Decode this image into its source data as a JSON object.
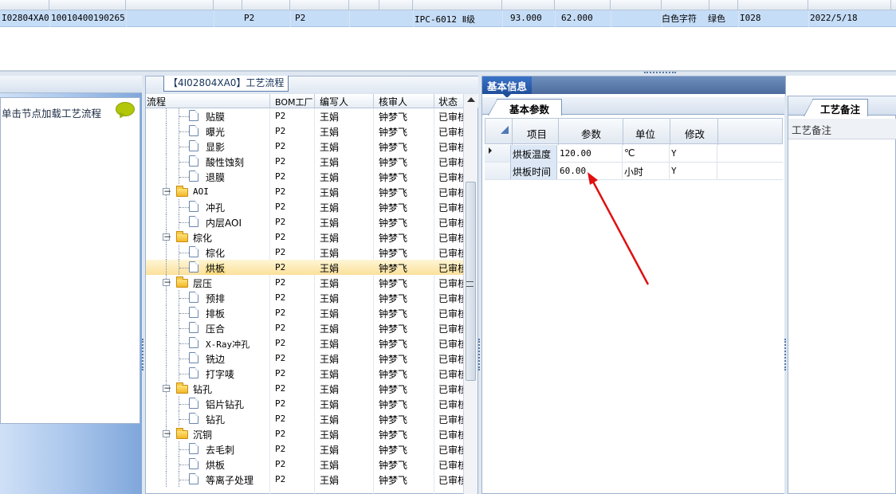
{
  "top_grid": {
    "selected_row": {
      "code": "I02804XA0",
      "number": "10010400190265",
      "c3": "P2",
      "c4": "P2",
      "grade": "IPC-6012 Ⅱ级",
      "v1": "93.000",
      "v2": "62.000",
      "ink": "白色字符",
      "color": "绿色",
      "code2": "I028",
      "date": "2022/5/18"
    }
  },
  "left_panel": {
    "hint": "单击节点加载工艺流程",
    "icon": "speech-bubble-icon"
  },
  "tree_panel": {
    "title": "【4I02804XA0】工艺流程",
    "columns": {
      "flow": "流程",
      "bom": "BOM工厂",
      "writer": "编写人",
      "reviewer": "核审人",
      "status": "状态"
    },
    "rows": [
      {
        "label": "贴膜",
        "type": "doc",
        "bom": "P2",
        "writer": "王娟",
        "reviewer": "钟梦飞",
        "status": "已审核"
      },
      {
        "label": "曝光",
        "type": "doc",
        "bom": "P2",
        "writer": "王娟",
        "reviewer": "钟梦飞",
        "status": "已审核"
      },
      {
        "label": "显影",
        "type": "doc",
        "bom": "P2",
        "writer": "王娟",
        "reviewer": "钟梦飞",
        "status": "已审核"
      },
      {
        "label": "酸性蚀刻",
        "type": "doc",
        "bom": "P2",
        "writer": "王娟",
        "reviewer": "钟梦飞",
        "status": "已审核"
      },
      {
        "label": "退膜",
        "type": "doc",
        "bom": "P2",
        "writer": "王娟",
        "reviewer": "钟梦飞",
        "status": "已审核"
      },
      {
        "label": "AOI",
        "type": "folder",
        "bom": "P2",
        "writer": "王娟",
        "reviewer": "钟梦飞",
        "status": "已审核"
      },
      {
        "label": "冲孔",
        "type": "doc",
        "bom": "P2",
        "writer": "王娟",
        "reviewer": "钟梦飞",
        "status": "已审核"
      },
      {
        "label": "内层AOI",
        "type": "doc",
        "bom": "P2",
        "writer": "王娟",
        "reviewer": "钟梦飞",
        "status": "已审核"
      },
      {
        "label": "棕化",
        "type": "folder",
        "bom": "P2",
        "writer": "王娟",
        "reviewer": "钟梦飞",
        "status": "已审核"
      },
      {
        "label": "棕化",
        "type": "doc",
        "bom": "P2",
        "writer": "王娟",
        "reviewer": "钟梦飞",
        "status": "已审核"
      },
      {
        "label": "烘板",
        "type": "doc",
        "bom": "P2",
        "writer": "王娟",
        "reviewer": "钟梦飞",
        "status": "已审核",
        "selected": true
      },
      {
        "label": "层压",
        "type": "folder",
        "bom": "P2",
        "writer": "王娟",
        "reviewer": "钟梦飞",
        "status": "已审核"
      },
      {
        "label": "预排",
        "type": "doc",
        "bom": "P2",
        "writer": "王娟",
        "reviewer": "钟梦飞",
        "status": "已审核"
      },
      {
        "label": "排板",
        "type": "doc",
        "bom": "P2",
        "writer": "王娟",
        "reviewer": "钟梦飞",
        "status": "已审核"
      },
      {
        "label": "压合",
        "type": "doc",
        "bom": "P2",
        "writer": "王娟",
        "reviewer": "钟梦飞",
        "status": "已审核"
      },
      {
        "label": "X-Ray冲孔",
        "type": "doc",
        "bom": "P2",
        "writer": "王娟",
        "reviewer": "钟梦飞",
        "status": "已审核"
      },
      {
        "label": "铣边",
        "type": "doc",
        "bom": "P2",
        "writer": "王娟",
        "reviewer": "钟梦飞",
        "status": "已审核"
      },
      {
        "label": "打字唛",
        "type": "doc",
        "bom": "P2",
        "writer": "王娟",
        "reviewer": "钟梦飞",
        "status": "已审核"
      },
      {
        "label": "钻孔",
        "type": "folder",
        "bom": "P2",
        "writer": "王娟",
        "reviewer": "钟梦飞",
        "status": "已审核"
      },
      {
        "label": "铝片钻孔",
        "type": "doc",
        "bom": "P2",
        "writer": "王娟",
        "reviewer": "钟梦飞",
        "status": "已审核"
      },
      {
        "label": "钻孔",
        "type": "doc",
        "bom": "P2",
        "writer": "王娟",
        "reviewer": "钟梦飞",
        "status": "已审核"
      },
      {
        "label": "沉铜",
        "type": "folder",
        "bom": "P2",
        "writer": "王娟",
        "reviewer": "钟梦飞",
        "status": "已审核"
      },
      {
        "label": "去毛刺",
        "type": "doc",
        "bom": "P2",
        "writer": "王娟",
        "reviewer": "钟梦飞",
        "status": "已审核"
      },
      {
        "label": "烘板",
        "type": "doc",
        "bom": "P2",
        "writer": "王娟",
        "reviewer": "钟梦飞",
        "status": "已审核"
      },
      {
        "label": "等离子处理",
        "type": "doc",
        "bom": "P2",
        "writer": "王娟",
        "reviewer": "钟梦飞",
        "status": "已审核"
      }
    ]
  },
  "basic_info": {
    "tab": "基本信息",
    "subtab": "基本参数",
    "columns": {
      "item": "项目",
      "param": "参数",
      "unit": "单位",
      "modify": "修改"
    },
    "rows": [
      {
        "item": "烘板温度",
        "param": "120.00",
        "unit": "℃",
        "modify": "Y"
      },
      {
        "item": "烘板时间",
        "param": "60.00",
        "unit": "小时",
        "modify": "Y"
      }
    ]
  },
  "remark": {
    "tab": "工艺备注",
    "header": "工艺备注"
  },
  "annotation_color": "#e01010"
}
